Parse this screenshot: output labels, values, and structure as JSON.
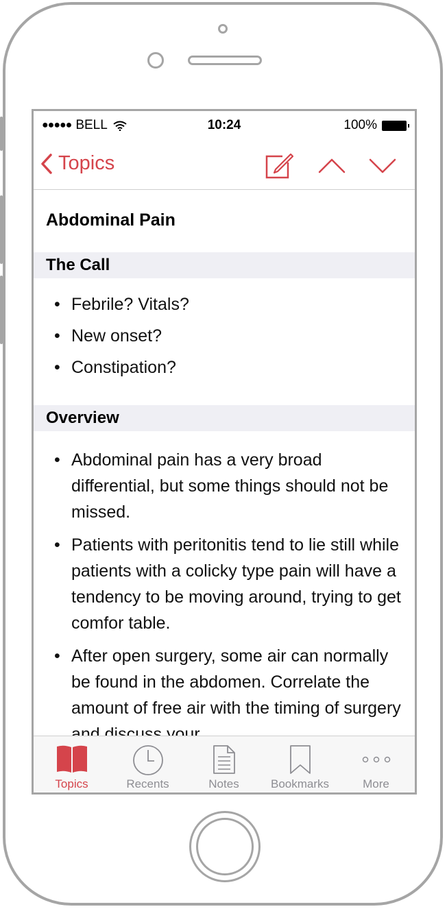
{
  "status_bar": {
    "signal_dots": "●●●●●",
    "carrier": "BELL",
    "time": "10:24",
    "battery": "100%"
  },
  "nav": {
    "back_label": "Topics"
  },
  "page": {
    "title": "Abdominal Pain"
  },
  "sections": [
    {
      "header": "The Call",
      "bullets": [
        "Febrile? Vitals?",
        "New onset?",
        "Constipation?"
      ]
    },
    {
      "header": "Overview",
      "bullets": [
        "Abdominal pain has a very broad differential, but some things should not be missed.",
        "Patients with peritonitis tend to lie still while patients with a colicky type pain will have a tendency to be moving around, trying to get comfor table.",
        "After open surgery, some air can normally be found in the abdomen. Correlate the amount of free air with the timing of surgery and discuss your"
      ]
    }
  ],
  "tabs": [
    {
      "label": "Topics",
      "icon": "book-icon",
      "active": true
    },
    {
      "label": "Recents",
      "icon": "clock-icon",
      "active": false
    },
    {
      "label": "Notes",
      "icon": "document-icon",
      "active": false
    },
    {
      "label": "Bookmarks",
      "icon": "bookmark-icon",
      "active": false
    },
    {
      "label": "More",
      "icon": "more-dots-icon",
      "active": false
    }
  ],
  "colors": {
    "accent": "#d5444b",
    "inactive": "#8e8e93",
    "section_bg": "#efeff4",
    "frame": "#a5a5a5"
  }
}
